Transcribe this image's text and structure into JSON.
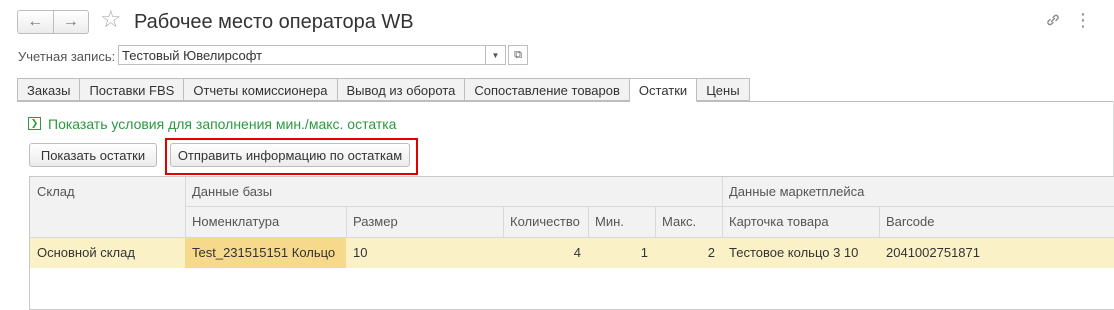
{
  "header": {
    "title": "Рабочее место оператора WB",
    "icons": [
      "back-icon",
      "forward-icon",
      "star-icon",
      "link-icon",
      "more-icon"
    ]
  },
  "account": {
    "label": "Учетная запись:",
    "value": "Тестовый Ювелирсофт"
  },
  "tabs": [
    {
      "label": "Заказы"
    },
    {
      "label": "Поставки FBS"
    },
    {
      "label": "Отчеты комиссионера"
    },
    {
      "label": "Вывод из оборота"
    },
    {
      "label": "Сопоставление товаров"
    },
    {
      "label": "Остатки",
      "active": true
    },
    {
      "label": "Цены"
    }
  ],
  "condition_link": "Показать условия для заполнения мин./макс. остатка",
  "buttons": {
    "show_stock": "Показать остатки",
    "send_stock": "Отправить информацию по остаткам"
  },
  "table": {
    "groups": {
      "warehouse": "Склад",
      "base_data": "Данные базы",
      "marketplace_data": "Данные маркетплейса"
    },
    "columns": {
      "nomenclature": "Номенклатура",
      "size": "Размер",
      "quantity": "Количество",
      "min": "Мин.",
      "max": "Макс.",
      "product_card": "Карточка товара",
      "barcode": "Barcode"
    },
    "rows": [
      {
        "warehouse": "Основной склад",
        "nomenclature": "Test_231515151 Кольцо",
        "size": "10",
        "quantity": "4",
        "min": "1",
        "max": "2",
        "product_card": "Тестовое кольцо 3 10",
        "barcode": "2041002751871"
      }
    ]
  },
  "colors": {
    "selected_row": "#fbf1c7",
    "selected_cell": "#f7d98b",
    "link_green": "#2b9a3f",
    "highlight_red": "#e00000"
  }
}
